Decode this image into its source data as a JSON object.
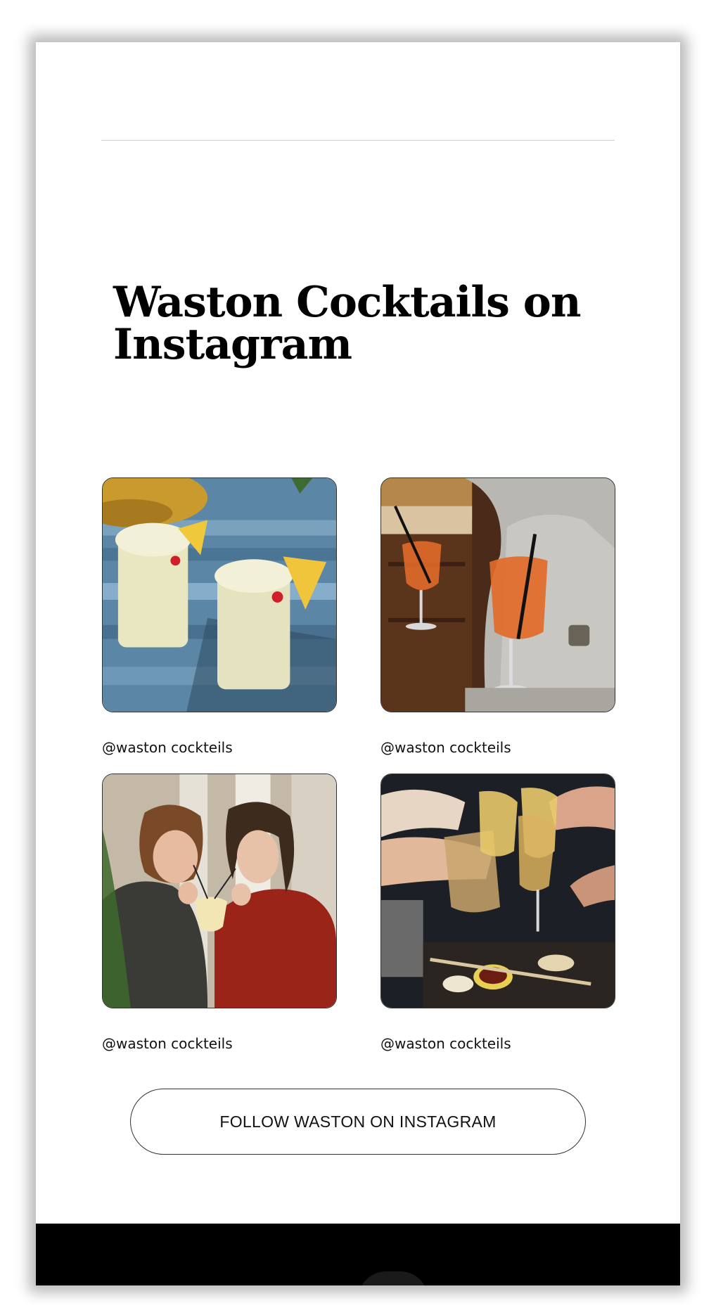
{
  "page": {
    "title": "Waston Cocktails on Instagram"
  },
  "posts": [
    {
      "handle": "@waston cockteils",
      "image": "pina-colada-photo"
    },
    {
      "handle": "@waston cockteils",
      "image": "spritz-glasses-photo"
    },
    {
      "handle": "@waston cockteils",
      "image": "couple-sharing-drink-photo"
    },
    {
      "handle": "@waston cockteils",
      "image": "cheers-toast-photo"
    }
  ],
  "follow_button": {
    "label": "FOLLOW WASTON ON INSTAGRAM"
  },
  "colors": {
    "background": "#ffffff",
    "text": "#000000",
    "footer": "#000000"
  }
}
